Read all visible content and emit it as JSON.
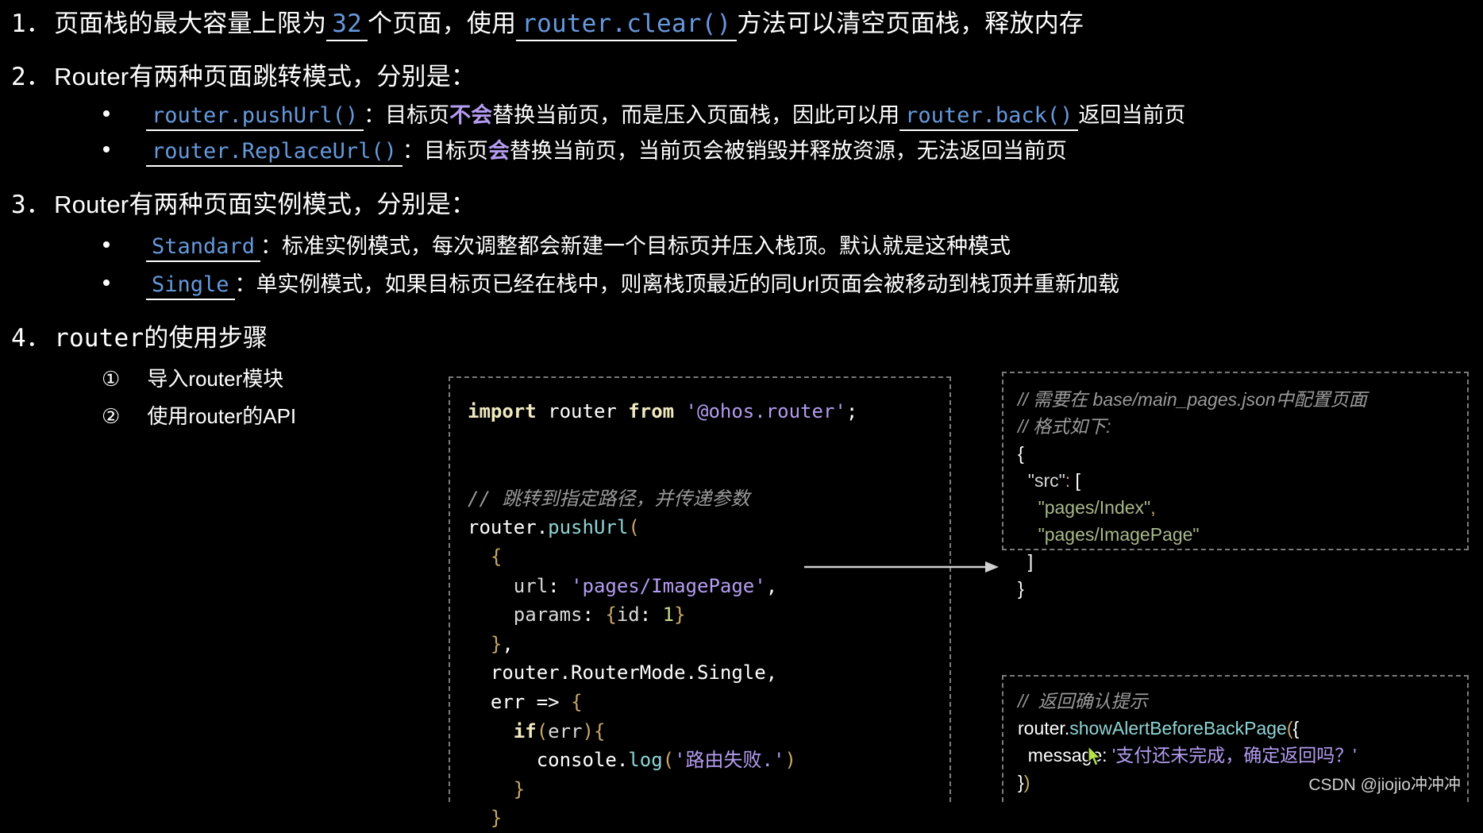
{
  "slide": {
    "background": "#000000",
    "accent_blue": "#6699dd",
    "accent_violet": "#b49cf0"
  },
  "outline": [
    {
      "number": "1．",
      "parts": [
        {
          "text": "页面栈的最大容量上限为",
          "style": "plain"
        },
        {
          "text": "32",
          "style": "underline-blue"
        },
        {
          "text": "个页面，使用",
          "style": "plain"
        },
        {
          "text": "router.clear()",
          "style": "underline-blue"
        },
        {
          "text": "方法可以清空页面栈，释放内存",
          "style": "plain"
        }
      ]
    },
    {
      "number": "2．",
      "parts": [
        {
          "text": "Router有两种页面跳转模式，分别是：",
          "style": "plain"
        }
      ],
      "children": [
        {
          "parts": [
            {
              "text": "router.pushUrl()",
              "style": "underline-blue"
            },
            {
              "text": "：目标页",
              "style": "plain"
            },
            {
              "text": "不会",
              "style": "violet"
            },
            {
              "text": "替换当前页，而是压入页面栈，因此可以用",
              "style": "plain"
            },
            {
              "text": "router.back()",
              "style": "underline-blue"
            },
            {
              "text": "返回当前页",
              "style": "plain"
            }
          ]
        },
        {
          "parts": [
            {
              "text": "router.ReplaceUrl()",
              "style": "underline-blue"
            },
            {
              "text": "：目标页",
              "style": "plain"
            },
            {
              "text": "会",
              "style": "violet"
            },
            {
              "text": "替换当前页，当前页会被销毁并释放资源，无法返回当前页",
              "style": "plain"
            }
          ]
        }
      ]
    },
    {
      "number": "3．",
      "parts": [
        {
          "text": "Router有两种页面实例模式，分别是：",
          "style": "plain"
        }
      ],
      "children": [
        {
          "parts": [
            {
              "text": "Standard",
              "style": "underline-blue"
            },
            {
              "text": "：标准实例模式，每次调整都会新建一个目标页并压入栈顶。默认就是这种模式",
              "style": "plain"
            }
          ]
        },
        {
          "parts": [
            {
              "text": "Single",
              "style": "underline-blue"
            },
            {
              "text": "：单实例模式，如果目标页已经在栈中，则离栈顶最近的同Url页面会被移动到栈顶并重新加载",
              "style": "plain"
            }
          ]
        }
      ]
    },
    {
      "number": "4．",
      "parts": [
        {
          "text": "router的使用步骤",
          "style": "plain"
        }
      ],
      "steps": [
        {
          "marker": "①",
          "label": "导入router模块"
        },
        {
          "marker": "②",
          "label": "使用router的API"
        }
      ]
    }
  ],
  "code_main": {
    "lines": [
      [
        {
          "t": "import",
          "c": "t-kw"
        },
        {
          "t": " router ",
          "c": "t-plain"
        },
        {
          "t": "from",
          "c": "t-kw"
        },
        {
          "t": " ",
          "c": "t-plain"
        },
        {
          "t": "'@ohos.router'",
          "c": "t-str"
        },
        {
          "t": ";",
          "c": "t-plain"
        }
      ],
      [],
      [],
      [
        {
          "t": "// 跳转到指定路径，并传递参数",
          "c": "t-comment"
        }
      ],
      [
        {
          "t": "router.",
          "c": "t-plain"
        },
        {
          "t": "pushUrl",
          "c": "t-fn"
        },
        {
          "t": "(",
          "c": "t-punc"
        }
      ],
      [
        {
          "t": "  ",
          "c": "t-plain"
        },
        {
          "t": "{",
          "c": "t-punc"
        }
      ],
      [
        {
          "t": "    url",
          "c": "t-prop"
        },
        {
          "t": ": ",
          "c": "t-plain"
        },
        {
          "t": "'pages/ImagePage'",
          "c": "t-str"
        },
        {
          "t": ",",
          "c": "t-plain"
        }
      ],
      [
        {
          "t": "    params",
          "c": "t-prop"
        },
        {
          "t": ": ",
          "c": "t-plain"
        },
        {
          "t": "{",
          "c": "t-punc"
        },
        {
          "t": "id",
          "c": "t-prop"
        },
        {
          "t": ": ",
          "c": "t-plain"
        },
        {
          "t": "1",
          "c": "t-num"
        },
        {
          "t": "}",
          "c": "t-punc"
        }
      ],
      [
        {
          "t": "  ",
          "c": "t-plain"
        },
        {
          "t": "}",
          "c": "t-punc"
        },
        {
          "t": ",",
          "c": "t-plain"
        }
      ],
      [
        {
          "t": "  router.RouterMode.Single,",
          "c": "t-plain"
        }
      ],
      [
        {
          "t": "  err ",
          "c": "t-plain"
        },
        {
          "t": "=>",
          "c": "t-plain"
        },
        {
          "t": " ",
          "c": "t-plain"
        },
        {
          "t": "{",
          "c": "t-punc"
        }
      ],
      [
        {
          "t": "    ",
          "c": "t-plain"
        },
        {
          "t": "if",
          "c": "t-kw"
        },
        {
          "t": "(",
          "c": "t-punc"
        },
        {
          "t": "err",
          "c": "t-prop"
        },
        {
          "t": ")",
          "c": "t-punc"
        },
        {
          "t": "{",
          "c": "t-punc"
        }
      ],
      [
        {
          "t": "      console.",
          "c": "t-plain"
        },
        {
          "t": "log",
          "c": "t-fn"
        },
        {
          "t": "(",
          "c": "t-punc"
        },
        {
          "t": "'路由失败.'",
          "c": "t-str"
        },
        {
          "t": ")",
          "c": "t-punc"
        }
      ],
      [
        {
          "t": "    ",
          "c": "t-plain"
        },
        {
          "t": "}",
          "c": "t-punc"
        }
      ],
      [
        {
          "t": "  ",
          "c": "t-plain"
        },
        {
          "t": "}",
          "c": "t-punc"
        }
      ]
    ]
  },
  "code_config": {
    "lines": [
      [
        {
          "t": "// 需要在 base/main_pages.json中配置页面",
          "c": "t-comment"
        }
      ],
      [
        {
          "t": "// 格式如下:",
          "c": "t-comment"
        }
      ],
      [
        {
          "t": "{",
          "c": "t-plain"
        }
      ],
      [
        {
          "t": "  ",
          "c": "t-plain"
        },
        {
          "t": "\"src\"",
          "c": "t-prop"
        },
        {
          "t": ":",
          "c": "t-punc"
        },
        {
          "t": " [",
          "c": "t-plain"
        }
      ],
      [
        {
          "t": "    ",
          "c": "t-plain"
        },
        {
          "t": "\"pages/Index\"",
          "c": "t-str2"
        },
        {
          "t": ",",
          "c": "t-punc"
        }
      ],
      [
        {
          "t": "    ",
          "c": "t-plain"
        },
        {
          "t": "\"pages/ImagePage\"",
          "c": "t-str2"
        }
      ],
      [
        {
          "t": "  ]",
          "c": "t-plain"
        }
      ],
      [
        {
          "t": "}",
          "c": "t-plain"
        }
      ]
    ]
  },
  "code_alert": {
    "lines": [
      [
        {
          "t": "//  返回确认提示",
          "c": "t-comment"
        }
      ],
      [
        {
          "t": "router.",
          "c": "t-plain"
        },
        {
          "t": "showAlertBeforeBackPage",
          "c": "t-fn"
        },
        {
          "t": "(",
          "c": "t-punc"
        },
        {
          "t": "{",
          "c": "t-plain"
        }
      ],
      [
        {
          "t": "  message",
          "c": "t-plain"
        },
        {
          "t": ": ",
          "c": "t-plain"
        },
        {
          "t": "'支付还未完成，确定返回吗？'",
          "c": "t-str"
        }
      ],
      [
        {
          "t": "}",
          "c": "t-plain"
        },
        {
          "t": ")",
          "c": "t-punc"
        }
      ]
    ]
  },
  "annotations": {
    "arrow_label": "url-to-config-arrow"
  },
  "watermark": "CSDN @jiojio冲冲冲"
}
